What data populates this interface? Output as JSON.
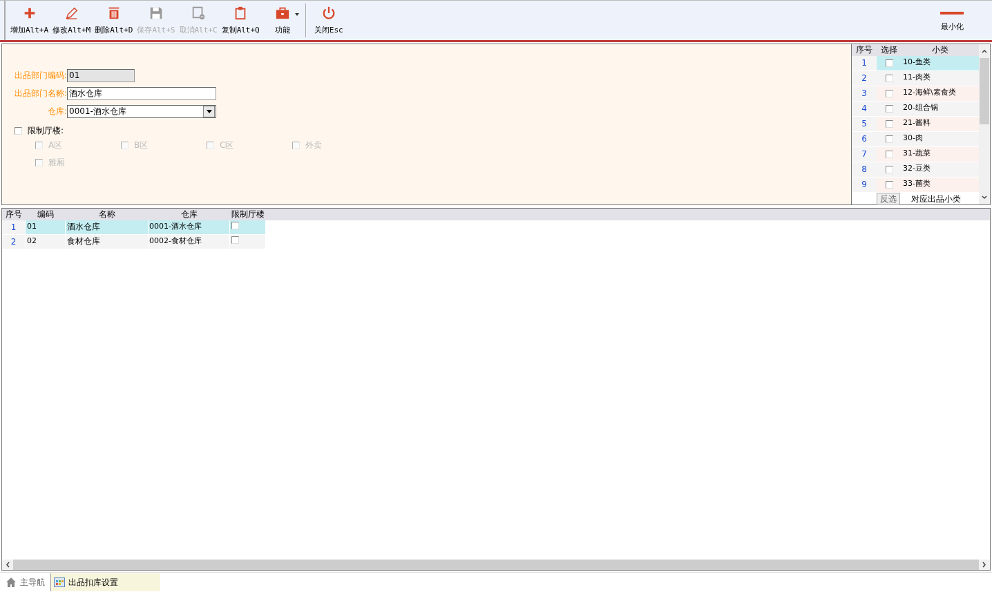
{
  "toolbar": {
    "buttons": [
      {
        "kind": "add",
        "label": "增加Alt+A",
        "disabled": false
      },
      {
        "kind": "edit",
        "label": "修改Alt+M",
        "disabled": false
      },
      {
        "kind": "delete",
        "label": "删除Alt+D",
        "disabled": false
      },
      {
        "kind": "save",
        "label": "保存Alt+S",
        "disabled": true
      },
      {
        "kind": "cancel",
        "label": "取消Alt+C",
        "disabled": true
      },
      {
        "kind": "copy",
        "label": "复制Alt+Q",
        "disabled": false
      },
      {
        "kind": "tools",
        "label": "功能",
        "disabled": false
      },
      {
        "kind": "close",
        "label": "关闭Esc",
        "disabled": false
      }
    ],
    "minimize": {
      "label": "最小化"
    }
  },
  "form": {
    "code": {
      "label": "出品部门编码:",
      "value": "01"
    },
    "name": {
      "label": "出品部门名称:",
      "value": "酒水仓库"
    },
    "warehouse": {
      "label": "仓库:",
      "value": "0001-酒水仓库"
    },
    "restrict": {
      "label": "限制厅楼:",
      "checked": false
    },
    "areas": [
      {
        "label": "A区",
        "checked": false,
        "disabled": true
      },
      {
        "label": "B区",
        "checked": false,
        "disabled": true
      },
      {
        "label": "C区",
        "checked": false,
        "disabled": true
      },
      {
        "label": "外卖",
        "checked": false,
        "disabled": true
      },
      {
        "label": "雅厢",
        "checked": false,
        "disabled": true
      }
    ]
  },
  "category_panel": {
    "columns": [
      "序号",
      "选择",
      "小类"
    ],
    "rows": [
      {
        "no": "1",
        "checked": false,
        "name": "10-鱼类",
        "selected": true
      },
      {
        "no": "2",
        "checked": false,
        "name": "11-肉类",
        "selected": false
      },
      {
        "no": "3",
        "checked": false,
        "name": "12-海鲜\\素食类",
        "selected": false
      },
      {
        "no": "4",
        "checked": false,
        "name": "20-组合锅",
        "selected": false
      },
      {
        "no": "5",
        "checked": false,
        "name": "21-酱料",
        "selected": false
      },
      {
        "no": "6",
        "checked": false,
        "name": "30-肉",
        "selected": false
      },
      {
        "no": "7",
        "checked": false,
        "name": "31-蔬菜",
        "selected": false
      },
      {
        "no": "8",
        "checked": false,
        "name": "32-豆类",
        "selected": false
      },
      {
        "no": "9",
        "checked": false,
        "name": "33-菌类",
        "selected": false
      }
    ],
    "invert_button": "反选",
    "caption": "对应出品小类"
  },
  "table": {
    "columns": [
      "序号",
      "编码",
      "名称",
      "仓库",
      "限制厅楼"
    ],
    "rows": [
      {
        "no": "1",
        "code": "01",
        "name": "酒水仓库",
        "warehouse": "0001-酒水仓库",
        "restricted": false,
        "selected": true
      },
      {
        "no": "2",
        "code": "02",
        "name": "食材仓库",
        "warehouse": "0002-食材仓库",
        "restricted": false,
        "selected": false
      }
    ]
  },
  "status_bar": {
    "tabs": [
      {
        "kind": "home",
        "label": "主导航",
        "selected": false
      },
      {
        "kind": "page",
        "label": "出品扣库设置",
        "selected": true
      }
    ]
  }
}
